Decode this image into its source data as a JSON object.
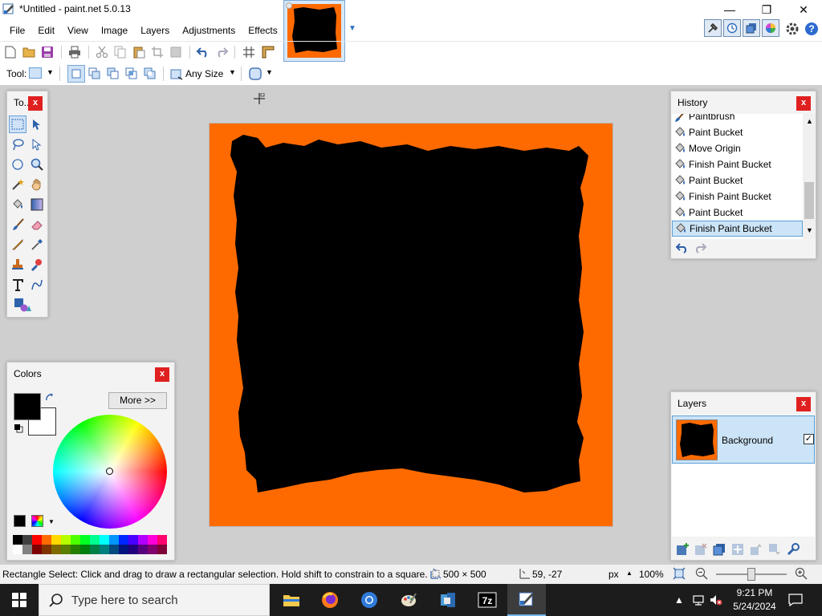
{
  "window": {
    "title": "*Untitled - paint.net 5.0.13",
    "minimize_glyph": "—",
    "maximize_glyph": "❐",
    "close_glyph": "✕"
  },
  "menu": {
    "items": [
      "File",
      "Edit",
      "View",
      "Image",
      "Layers",
      "Adjustments",
      "Effects"
    ]
  },
  "toolbar": {
    "tool_label": "Tool:",
    "size_mode": "Any Size"
  },
  "tools_panel": {
    "title": "To...",
    "close": "x"
  },
  "history_panel": {
    "title": "History",
    "close": "x",
    "items": [
      "Paintbrush",
      "Paint Bucket",
      "Move Origin",
      "Finish Paint Bucket",
      "Paint Bucket",
      "Finish Paint Bucket",
      "Paint Bucket",
      "Finish Paint Bucket"
    ],
    "selected_index": 7
  },
  "colors_panel": {
    "title": "Colors",
    "close": "x",
    "more_button": "More >>",
    "primary_color": "#000000",
    "secondary_color": "#ffffff"
  },
  "layers_panel": {
    "title": "Layers",
    "close": "x",
    "layer_name": "Background",
    "layer_visible": true
  },
  "canvas": {
    "background_color": "#ff6a00",
    "fill_color": "#000000"
  },
  "status": {
    "hint": "Rectangle Select: Click and drag to draw a rectangular selection. Hold shift to constrain to a square.",
    "image_size": "500 × 500",
    "cursor_pos": "59, -27",
    "units": "px",
    "zoom": "100%"
  },
  "taskbar": {
    "search_placeholder": "Type here to search",
    "time": "9:21 PM",
    "date": "5/24/2024"
  },
  "palette": [
    "#000000",
    "#404040",
    "#ff0000",
    "#ff6a00",
    "#ffd800",
    "#b6ff00",
    "#4cff00",
    "#00ff21",
    "#00ff90",
    "#00ffff",
    "#0094ff",
    "#0026ff",
    "#4800ff",
    "#b200ff",
    "#ff00dc",
    "#ff006e"
  ],
  "palette_dark": [
    "#ffffff",
    "#808080",
    "#7f0000",
    "#7f3300",
    "#7f6a00",
    "#5b7f00",
    "#267f00",
    "#007f0e",
    "#007f46",
    "#007f7f",
    "#004a7f",
    "#00137f",
    "#21007f",
    "#57007f",
    "#7f006e",
    "#7f0037"
  ]
}
